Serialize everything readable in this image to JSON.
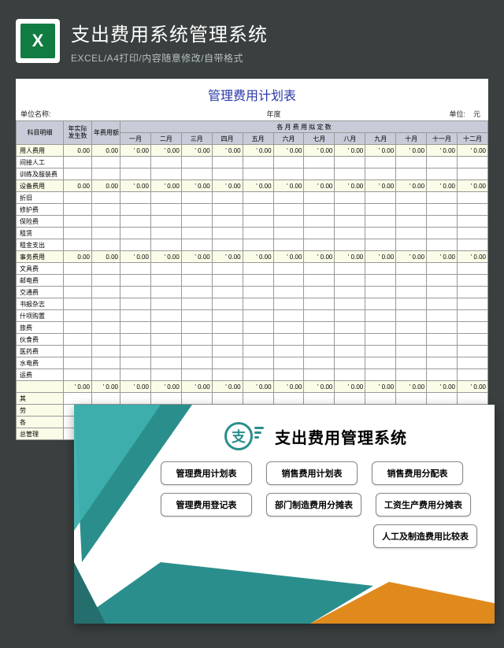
{
  "header": {
    "title": "支出费用系统管理系统",
    "subtitle": "EXCEL/A4打印/内容随意修改/自带格式",
    "excel_letter": "X"
  },
  "sheet": {
    "title": "管理费用计划表",
    "meta": {
      "unit_label": "单位名称:",
      "year_label": "年度",
      "count_label": "单位:",
      "currency": "元"
    },
    "col_main": "科目明细",
    "col_actual": "年实际\n发生数",
    "col_budget": "年费用额",
    "col_months_header": "各 月 费 用 拟 定 数",
    "months": [
      "一月",
      "二月",
      "三月",
      "四月",
      "五月",
      "六月",
      "七月",
      "八月",
      "九月",
      "十月",
      "十一月",
      "十二月"
    ],
    "rows": [
      {
        "label": "用人费用",
        "sum": true
      },
      {
        "label": "间接人工",
        "sum": false
      },
      {
        "label": "训练及服装费",
        "sum": false
      },
      {
        "label": "设备费用",
        "sum": true
      },
      {
        "label": "折旧",
        "sum": false
      },
      {
        "label": "修护费",
        "sum": false
      },
      {
        "label": "保险费",
        "sum": false
      },
      {
        "label": "租赁",
        "sum": false
      },
      {
        "label": "租金支出",
        "sum": false
      },
      {
        "label": "事务费用",
        "sum": true
      },
      {
        "label": "文具费",
        "sum": false
      },
      {
        "label": "邮电费",
        "sum": false
      },
      {
        "label": "交通费",
        "sum": false
      },
      {
        "label": "书报杂志",
        "sum": false
      },
      {
        "label": "什项购置",
        "sum": false
      },
      {
        "label": "旅费",
        "sum": false
      },
      {
        "label": "伙食费",
        "sum": false
      },
      {
        "label": "医药费",
        "sum": false
      },
      {
        "label": "水电费",
        "sum": false
      },
      {
        "label": "运费",
        "sum": false
      }
    ],
    "tail": [
      "其",
      "劳",
      "各",
      "总管理"
    ],
    "zero": "0.00",
    "zero_small": "' 0.00"
  },
  "card": {
    "coin_char": "支",
    "title": "支出费用管理系统",
    "buttons": [
      [
        "管理费用计划表",
        "销售费用计划表",
        "销售费用分配表"
      ],
      [
        "管理费用登记表",
        "部门制造费用分摊表",
        "工资生产费用分摊表"
      ],
      [
        "人工及制造费用比较表"
      ]
    ]
  }
}
